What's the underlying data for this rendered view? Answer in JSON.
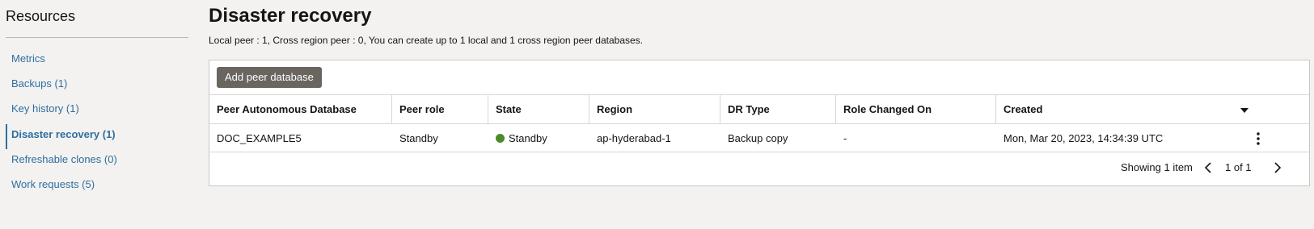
{
  "sidebar": {
    "title": "Resources",
    "items": [
      {
        "label": "Metrics"
      },
      {
        "label": "Backups (1)"
      },
      {
        "label": "Key history (1)"
      },
      {
        "label": "Disaster recovery (1)"
      },
      {
        "label": "Refreshable clones (0)"
      },
      {
        "label": "Work requests (5)"
      }
    ],
    "active_index": 3
  },
  "main": {
    "title": "Disaster recovery",
    "summary": "Local peer : 1, Cross region peer : 0, You can create up to 1 local and 1 cross region peer databases.",
    "add_button": "Add peer database",
    "table": {
      "columns": [
        "Peer Autonomous Database",
        "Peer role",
        "State",
        "Region",
        "DR Type",
        "Role Changed On",
        "Created"
      ],
      "rows": [
        {
          "peer_db": "DOC_EXAMPLE5",
          "peer_role": "Standby",
          "state": "Standby",
          "state_color": "#4f8a2a",
          "region": "ap-hyderabad-1",
          "dr_type": "Backup copy",
          "role_changed_on": "-",
          "created": "Mon, Mar 20, 2023, 14:34:39 UTC"
        }
      ]
    },
    "footer": {
      "showing": "Showing 1 item",
      "page": "1 of 1"
    }
  },
  "icons": {
    "sort": "caret-down-icon",
    "row_actions": "kebab-menu-icon",
    "prev": "chevron-left-icon",
    "next": "chevron-right-icon",
    "state": "status-dot-icon"
  },
  "colors": {
    "link": "#2f6ea1",
    "button": "#6b6560",
    "available_green": "#4f8a2a"
  }
}
